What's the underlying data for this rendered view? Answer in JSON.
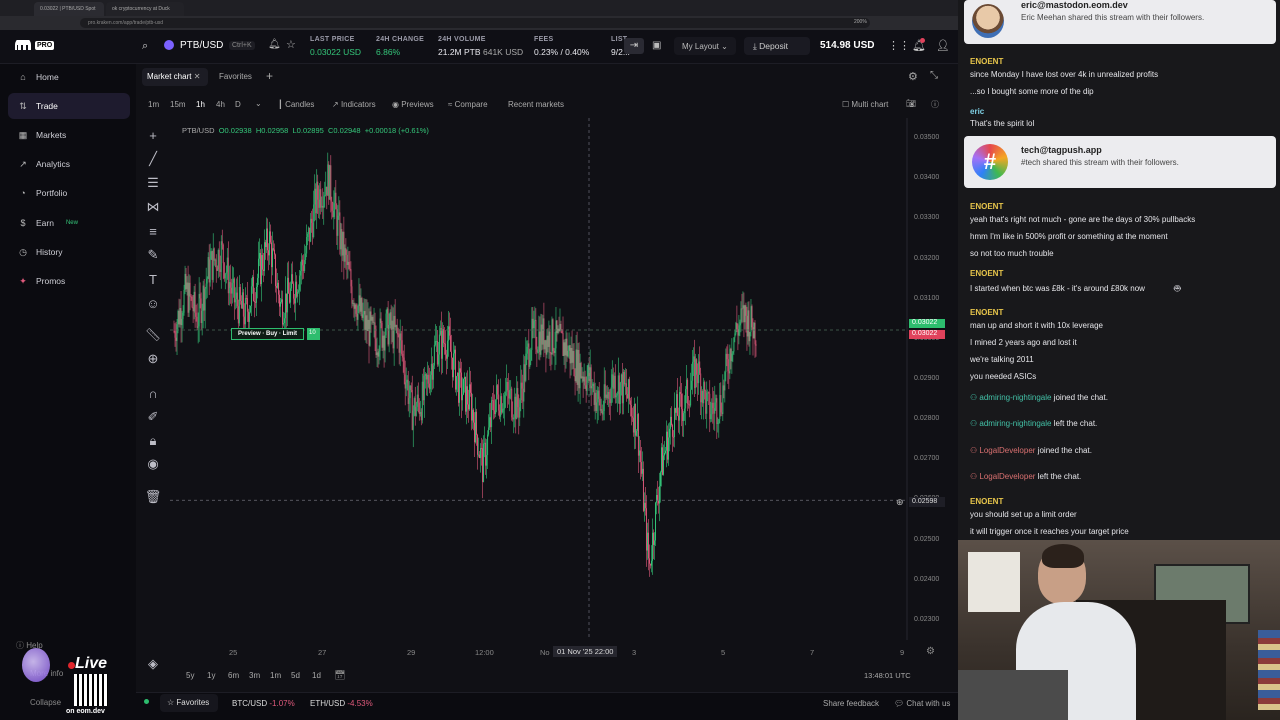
{
  "browser": {
    "tabs": [
      "0.03022 | PTB/USD Spot",
      "ok cryptocurrency at Duck"
    ],
    "url": "pro.kraken.com/app/trade/ptb-usd",
    "zoom": "200%"
  },
  "header": {
    "logo": "PRO",
    "pair": "PTB/USD",
    "shortcut": "Ctrl+K",
    "last_price_label": "LAST PRICE",
    "last_price_value": "0.03022 USD",
    "change_label": "24H CHANGE",
    "change_value": "6.86%",
    "volume_label": "24H VOLUME",
    "volume_value": "21.2M PTB",
    "volume_usd": "641K USD",
    "fees_label": "FEES",
    "fees_value": "0.23% / 0.40%",
    "listed_label": "LIST",
    "listed_value": "9/2...",
    "layout_label": "My Layout",
    "deposit_label": "Deposit",
    "balance": "514.98 USD"
  },
  "sidebar": {
    "items": [
      {
        "label": "Home",
        "icon": "home-icon"
      },
      {
        "label": "Trade",
        "icon": "trade-icon"
      },
      {
        "label": "Markets",
        "icon": "markets-icon"
      },
      {
        "label": "Analytics",
        "icon": "analytics-icon"
      },
      {
        "label": "Portfolio",
        "icon": "portfolio-icon"
      },
      {
        "label": "Earn",
        "icon": "earn-icon",
        "badge": "New"
      },
      {
        "label": "History",
        "icon": "history-icon"
      },
      {
        "label": "Promos",
        "icon": "promos-icon"
      }
    ],
    "help": "Help",
    "more_info": "More info",
    "collapse": "Collapse"
  },
  "chart_tabs": {
    "market_chart": "Market chart",
    "favorites": "Favorites"
  },
  "toolbar": {
    "timeframes": [
      "1m",
      "15m",
      "1h",
      "4h",
      "D"
    ],
    "active_timeframe": "1h",
    "candles": "Candles",
    "indicators": "Indicators",
    "previews": "Previews",
    "compare": "Compare",
    "recent_markets": "Recent markets",
    "multi_chart": "Multi chart"
  },
  "legend": {
    "symbol": "PTB/USD",
    "o": "O0.02938",
    "h": "H0.02958",
    "l": "L0.02895",
    "c": "C0.02948",
    "chg": "+0.00018 (+0.61%)"
  },
  "order_preview": {
    "label": "Preview · Buy · Limit",
    "qty": "10"
  },
  "chart_data": {
    "type": "candlestick",
    "title": "PTB/USD",
    "ylim": [
      0.0225,
      0.0355
    ],
    "yticks": [
      "0.03500",
      "0.03400",
      "0.03300",
      "0.03200",
      "0.03100",
      "0.03000",
      "0.02900",
      "0.02800",
      "0.02700",
      "0.02600",
      "0.02500",
      "0.02400",
      "0.02300"
    ],
    "xticks": [
      "25",
      "27",
      "29",
      "12:00",
      "No",
      "3",
      "5",
      "7",
      "9"
    ],
    "crosshair_x_label": "01 Nov '25   22:00",
    "crosshair_y_label": "0.02598",
    "last_price_tags": [
      "0.03022",
      "0.03022"
    ],
    "close_path": [
      0.0302,
      0.0312,
      0.0305,
      0.0318,
      0.0322,
      0.031,
      0.0306,
      0.0315,
      0.0325,
      0.0308,
      0.0312,
      0.032,
      0.0335,
      0.034,
      0.0325,
      0.0312,
      0.0304,
      0.03,
      0.0303,
      0.03,
      0.0282,
      0.0285,
      0.0298,
      0.03,
      0.0288,
      0.0284,
      0.0268,
      0.0285,
      0.0286,
      0.0283,
      0.03,
      0.0301,
      0.03,
      0.0298,
      0.0293,
      0.029,
      0.0282,
      0.029,
      0.0287,
      0.0279,
      0.0243,
      0.0268,
      0.028,
      0.0284,
      0.0293,
      0.0282,
      0.0284,
      0.03,
      0.0306,
      0.0302
    ]
  },
  "bottom": {
    "ranges": [
      "5y",
      "1y",
      "6m",
      "3m",
      "1m",
      "5d",
      "1d"
    ],
    "time_utc": "13:48:01 UTC",
    "favorites": "Favorites",
    "ticker1_pair": "BTC/USD",
    "ticker1_chg": "-1.07%",
    "ticker2_pair": "ETH/USD",
    "ticker2_chg": "-4.53%",
    "feedback": "Share feedback",
    "chat": "Chat with us"
  },
  "stream": {
    "live": "Live",
    "site": "on eom.dev"
  },
  "chat": {
    "card1_name": "eric@mastodon.eom.dev",
    "card1_text": "Eric Meehan shared this stream with their followers.",
    "card2_name": "tech@tagpush.app",
    "card2_text": "#tech shared this stream with their followers.",
    "messages": [
      {
        "user": "ENOENT",
        "lines": [
          "since Monday I have lost over 4k in unrealized profits",
          "...so I bought some more of the dip"
        ]
      },
      {
        "user": "eric",
        "lines": [
          "That's the spirit lol"
        ]
      },
      {
        "user": "ENOENT",
        "lines": [
          "yeah that's right not much - gone are the days of 30% pullbacks",
          "hmm I'm like in 500% profit or something at the moment",
          "so not too much trouble"
        ]
      },
      {
        "user": "ENOENT",
        "lines": [
          "I started when btc was £8k - it's around £80k now"
        ]
      },
      {
        "user": "ENOENT",
        "lines": [
          "man up and short it with 10x leverage",
          "I mined 2 years ago and lost it",
          "we're talking 2011",
          "you needed ASICs"
        ]
      },
      {
        "user": "ENOENT",
        "lines": [
          "you should set up a limit order",
          "it will trigger once it reaches your target price"
        ]
      }
    ],
    "events": [
      {
        "user": "admiring-nightingale",
        "text": "joined the chat."
      },
      {
        "user": "admiring-nightingale",
        "text": "left the chat."
      },
      {
        "user": "LogalDeveloper",
        "text": "joined the chat."
      },
      {
        "user": "LogalDeveloper",
        "text": "left the chat."
      }
    ]
  },
  "colors": {
    "up": "#35c77a",
    "down": "#e05a7c",
    "accent": "#7b61ff",
    "bg": "#101015"
  }
}
